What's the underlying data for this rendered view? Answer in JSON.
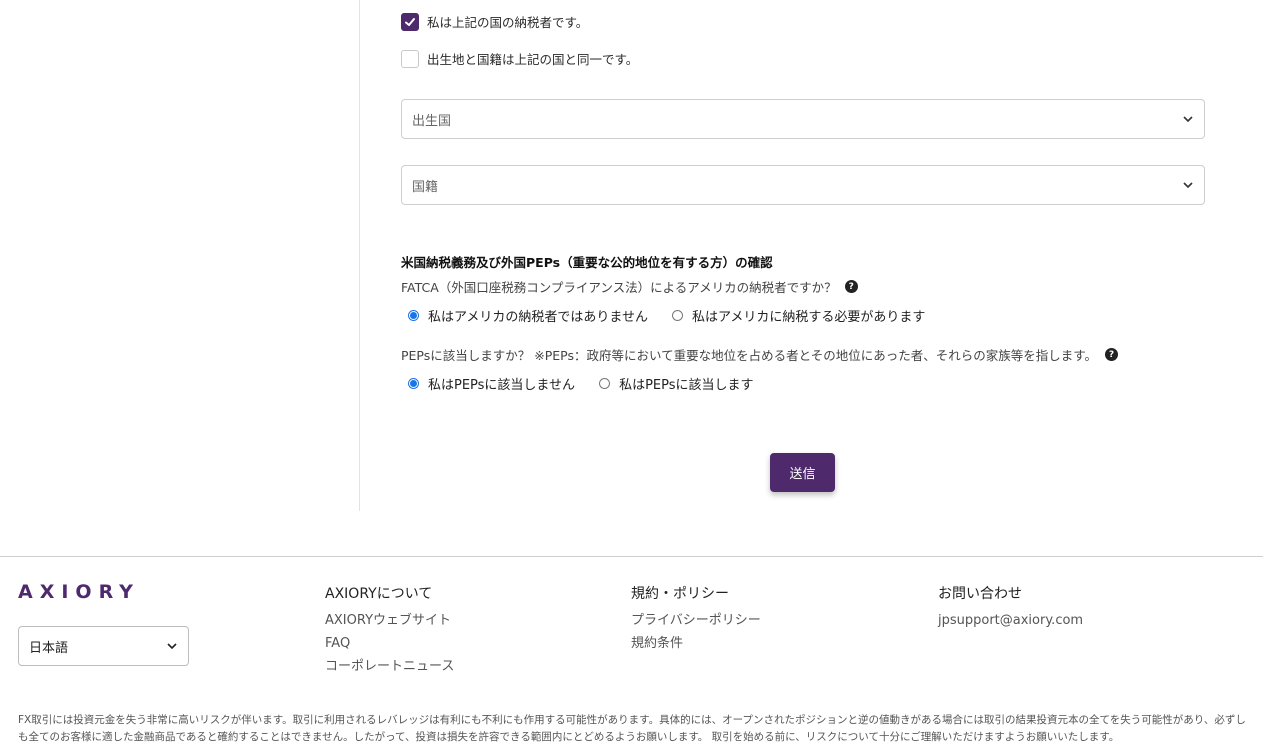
{
  "form": {
    "checkbox_taxpayer": {
      "label": "私は上記の国の納税者です。",
      "checked": true
    },
    "checkbox_same_country": {
      "label": "出生地と国籍は上記の国と同一です。",
      "checked": false
    },
    "birth_country_select": {
      "placeholder": "出生国"
    },
    "nationality_select": {
      "placeholder": "国籍"
    },
    "section_title": "米国納税義務及び外国PEPs（重要な公的地位を有する方）の確認",
    "fatca_question": "FATCA（外国口座税務コンプライアンス法）によるアメリカの納税者ですか？",
    "fatca_options": [
      {
        "label": "私はアメリカの納税者ではありません",
        "selected": true
      },
      {
        "label": "私はアメリカに納税する必要があります",
        "selected": false
      }
    ],
    "peps_question": "PEPsに該当しますか？ ※PEPs：政府等において重要な地位を占める者とその地位にあった者、それらの家族等を指します。",
    "peps_options": [
      {
        "label": "私はPEPsに該当しません",
        "selected": true
      },
      {
        "label": "私はPEPsに該当します",
        "selected": false
      }
    ],
    "submit_label": "送信"
  },
  "footer": {
    "logo_text": "AXIORY",
    "language_select": "日本語",
    "about": {
      "title": "AXIORYについて",
      "links": [
        "AXIORYウェブサイト",
        "FAQ",
        "コーポレートニュース"
      ]
    },
    "policy": {
      "title": "規約・ポリシー",
      "links": [
        "プライバシーポリシー",
        "規約条件"
      ]
    },
    "contact": {
      "title": "お問い合わせ",
      "links": [
        "jpsupport@axiory.com"
      ]
    },
    "disclaimer": "FX取引には投資元金を失う非常に高いリスクが伴います。取引に利用されるレバレッジは有利にも不利にも作用する可能性があります。具体的には、オープンされたポジションと逆の値動きがある場合には取引の結果投資元本の全てを失う可能性があり、必ずしも全てのお客様に適した金融商品であると確約することはできません。したがって、投資は損失を許容できる範囲内にとどめるようお願いします。 取引を始める前に、リスクについて十分にご理解いただけますようお願いいたします。"
  },
  "colors": {
    "brand": "#4e2a6d",
    "radio_selected": "#1a73e8"
  }
}
